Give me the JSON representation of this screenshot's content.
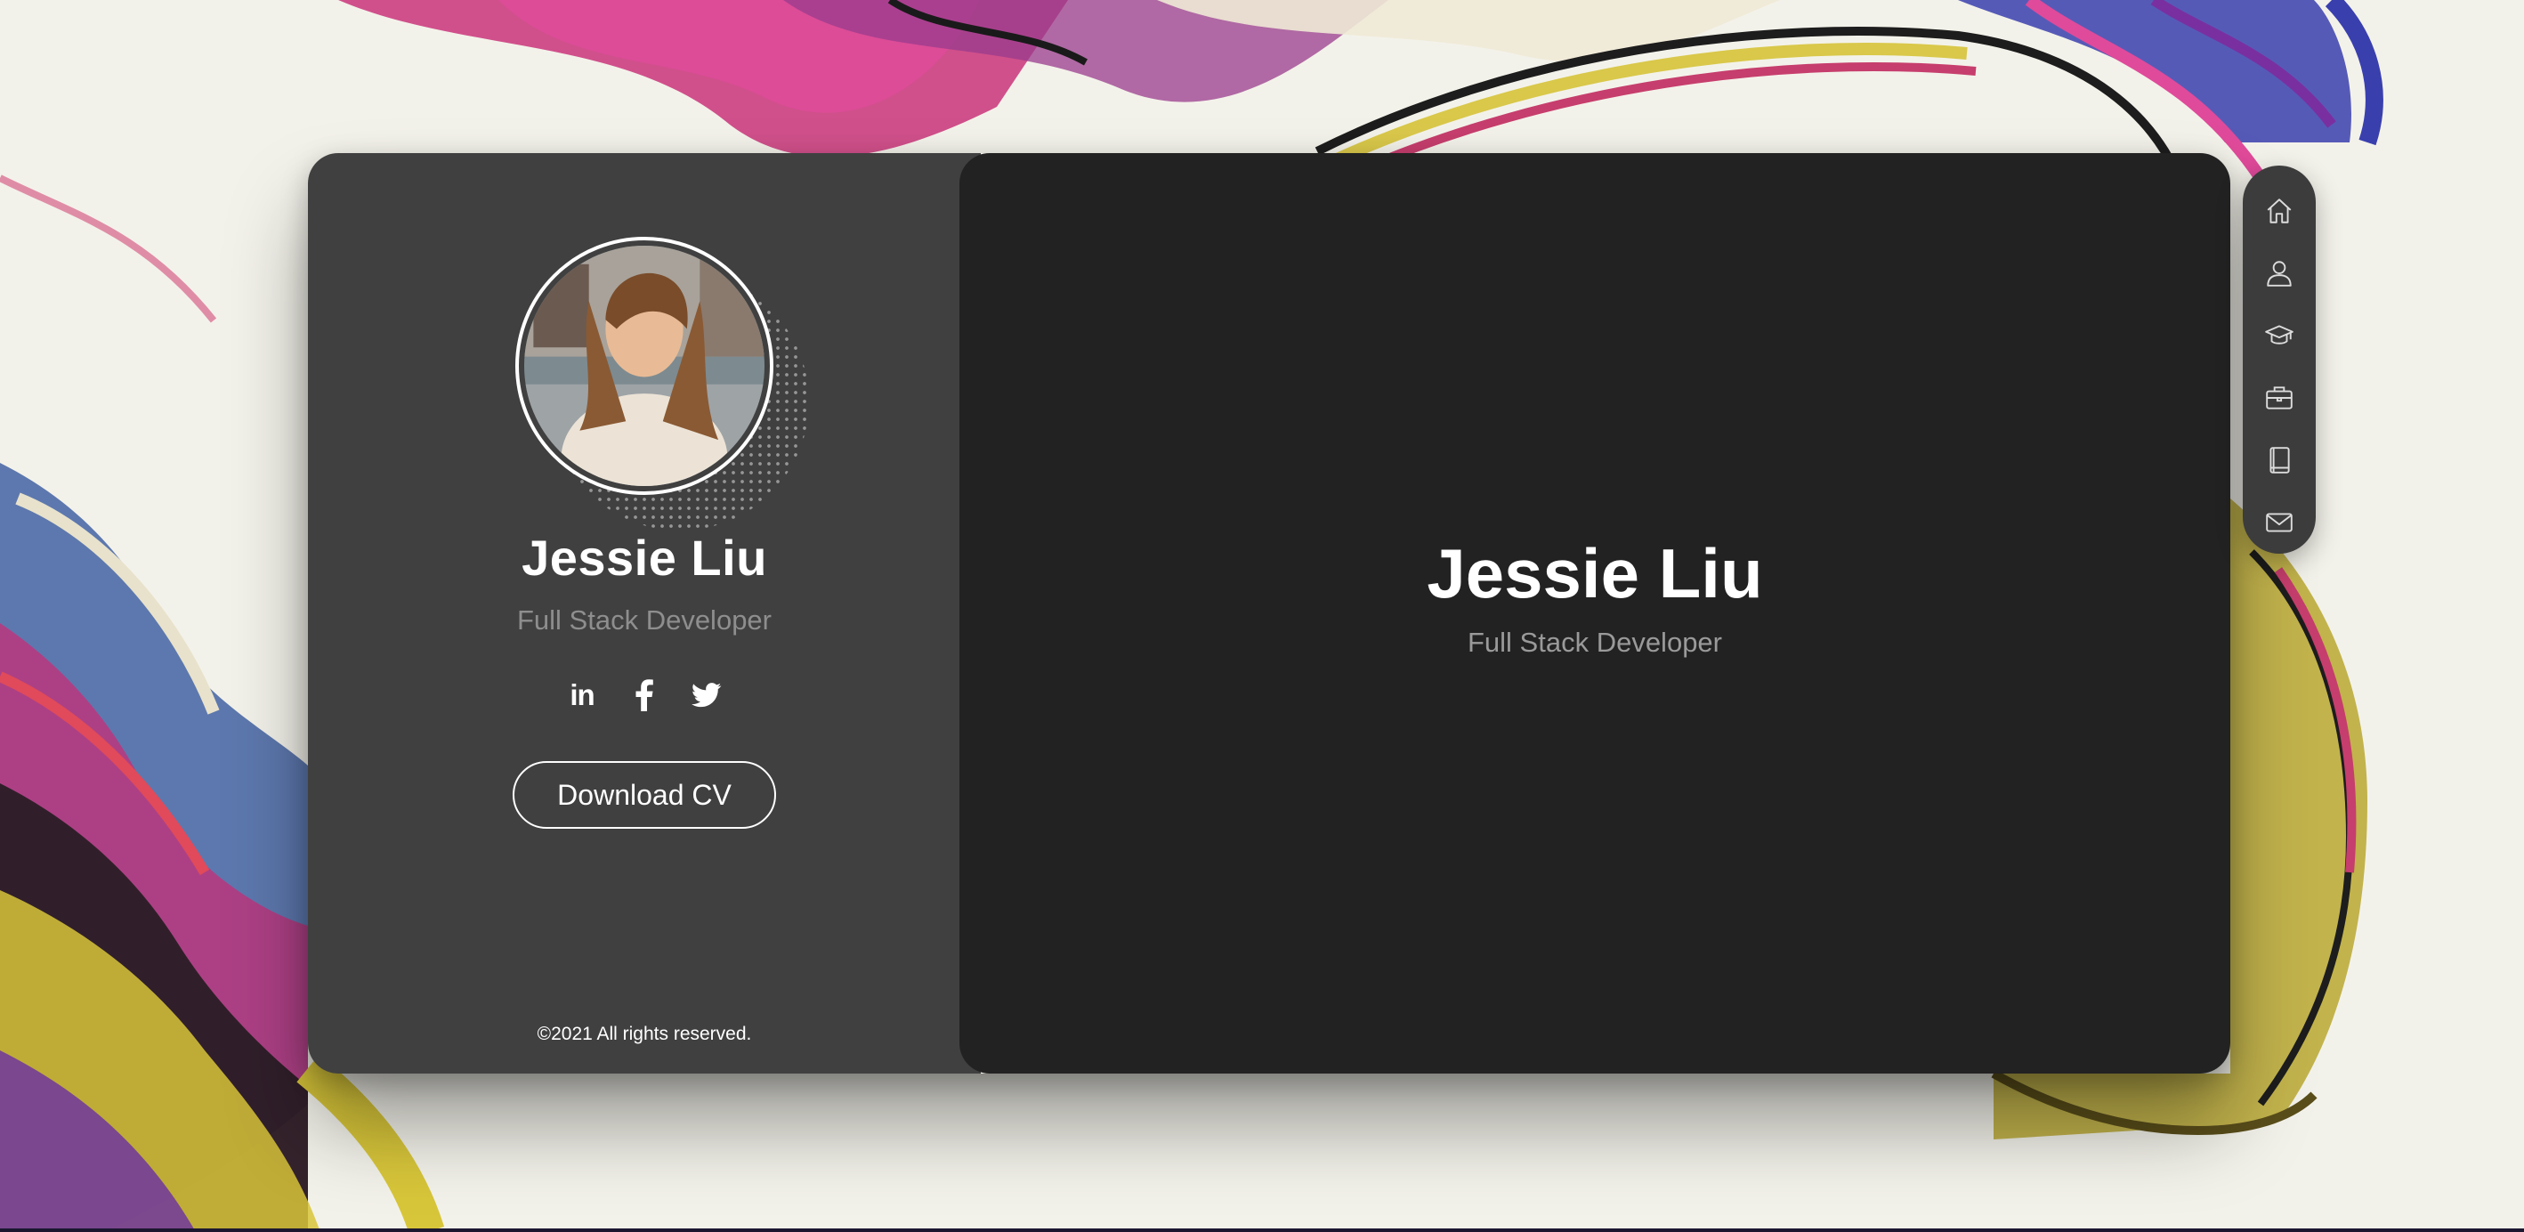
{
  "profile": {
    "name": "Jessie Liu",
    "role": "Full Stack Developer",
    "socials": [
      {
        "icon": "linkedin-icon",
        "label": "in"
      },
      {
        "icon": "facebook-icon",
        "label": "f"
      },
      {
        "icon": "twitter-icon",
        "label": ""
      }
    ],
    "download_label": "Download CV",
    "copyright": "©2021 All rights reserved."
  },
  "content": {
    "name": "Jessie Liu",
    "role": "Full Stack Developer"
  },
  "nav": {
    "items": [
      {
        "icon": "home-icon"
      },
      {
        "icon": "user-icon"
      },
      {
        "icon": "graduation-cap-icon"
      },
      {
        "icon": "briefcase-icon"
      },
      {
        "icon": "book-icon"
      },
      {
        "icon": "mail-icon"
      }
    ]
  },
  "colors": {
    "profile_bg": "#404040",
    "content_bg": "#222222",
    "nav_bg": "#3c3c3c",
    "text_primary": "#ffffff",
    "text_muted": "#8e8e8e"
  }
}
